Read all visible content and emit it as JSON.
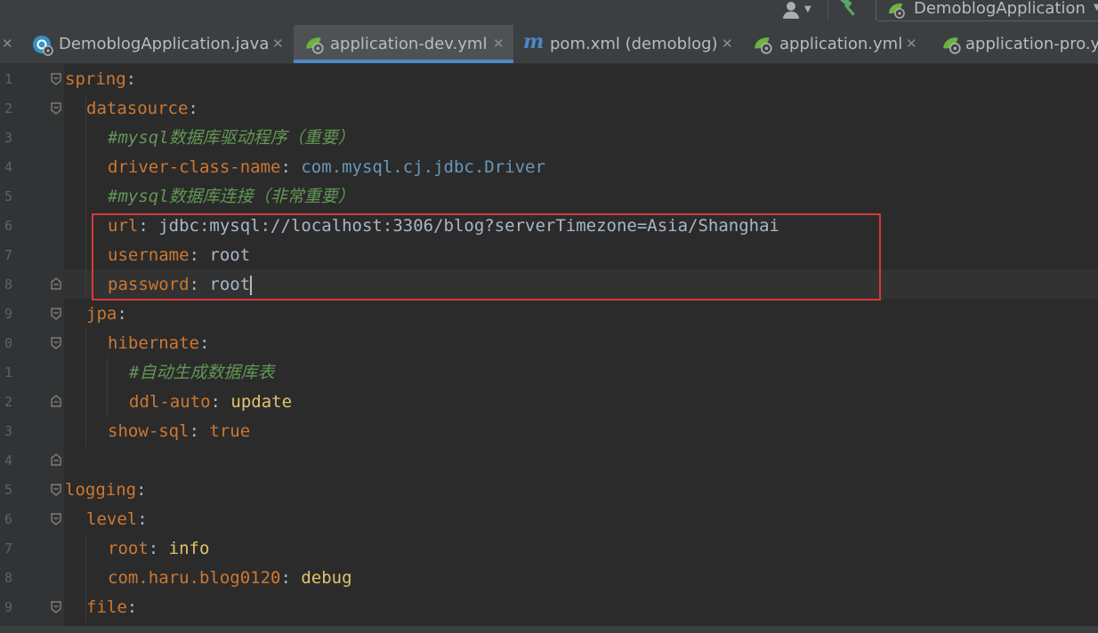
{
  "toolbar": {
    "run_config": "DemoblogApplication"
  },
  "tabs": [
    {
      "label": "DemoblogApplication.java",
      "icon": "java-class-icon"
    },
    {
      "label": "application-dev.yml",
      "icon": "spring-icon",
      "active": true
    },
    {
      "label": "pom.xml (demoblog)",
      "icon": "maven-icon"
    },
    {
      "label": "application.yml",
      "icon": "spring-icon"
    },
    {
      "label": "application-pro.y",
      "icon": "spring-icon"
    }
  ],
  "gutter": {
    "line_numbers": [
      "1",
      "2",
      "3",
      "4",
      "5",
      "6",
      "7",
      "8",
      "9",
      "0",
      "1",
      "2",
      "3",
      "4",
      "5",
      "6",
      "7",
      "8",
      "9"
    ]
  },
  "code": {
    "l1": {
      "key": "spring",
      "colon": ":"
    },
    "l2": {
      "key": "datasource",
      "colon": ":"
    },
    "l3": {
      "comment": "#mysql数据库驱动程序（重要）"
    },
    "l4": {
      "key": "driver-class-name",
      "colon": ": ",
      "value": "com.mysql.cj.jdbc.Driver"
    },
    "l5": {
      "comment": "#mysql数据库连接（非常重要）"
    },
    "l6": {
      "key": "url",
      "colon": ": ",
      "value": "jdbc:mysql://localhost:3306/blog?serverTimezone=Asia/Shanghai"
    },
    "l7": {
      "key": "username",
      "colon": ": ",
      "value": "root"
    },
    "l8": {
      "key": "password",
      "colon": ": ",
      "value": "root"
    },
    "l9": {
      "key": "jpa",
      "colon": ":"
    },
    "l10": {
      "key": "hibernate",
      "colon": ":"
    },
    "l11": {
      "comment": "#自动生成数据库表"
    },
    "l12": {
      "key": "ddl-auto",
      "colon": ": ",
      "value": "update"
    },
    "l13": {
      "key": "show-sql",
      "colon": ": ",
      "value": "true"
    },
    "l15": {
      "key": "logging",
      "colon": ":"
    },
    "l16": {
      "key": "level",
      "colon": ":"
    },
    "l17": {
      "key": "root",
      "colon": ": ",
      "value": "info"
    },
    "l18": {
      "key": "com.haru.blog0120",
      "colon": ": ",
      "value": "debug"
    },
    "l19": {
      "key": "file",
      "colon": ":"
    }
  },
  "colors": {
    "keyword": "#cc7832",
    "comment": "#629755",
    "value_bold": "#e0c46c",
    "value_class": "#6897bb",
    "highlight_box": "#d93838",
    "active_tab_underline": "#4a88c7"
  }
}
